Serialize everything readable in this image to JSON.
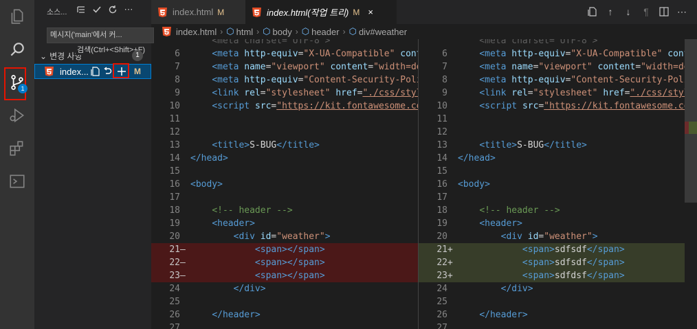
{
  "activity_bar": {
    "scm_badge": "1"
  },
  "sidebar": {
    "title": "소스...",
    "tooltip_commit": "메시지('main'에서 커...",
    "tooltip_search": "검색(Ctrl+<Shift>+F)",
    "changes_header": "변경 사항",
    "changes_count": "1",
    "file": {
      "name": "index...",
      "status": "M"
    }
  },
  "tabs": [
    {
      "label": "index.html",
      "status": "M"
    },
    {
      "label": "index.html(작업 트리)",
      "status": "M",
      "close": "×"
    }
  ],
  "breadcrumb": [
    "index.html",
    "html",
    "body",
    "header",
    "div#weather"
  ],
  "editor": {
    "left": [
      {
        "n": "",
        "marker": "",
        "kind": "plain",
        "code": [
          [
            "t-txt",
            "    <meta charset=\"UTF-8\">"
          ]
        ]
      },
      {
        "n": "6",
        "marker": "",
        "kind": "plain",
        "code": [
          [
            "t-txt",
            "    "
          ],
          [
            "t-tag",
            "<meta "
          ],
          [
            "t-attr",
            "http-equiv"
          ],
          [
            "t-txt",
            "="
          ],
          [
            "t-str",
            "\"X-UA-Compatible\""
          ],
          [
            "t-txt",
            " "
          ],
          [
            "t-attr",
            "cont"
          ]
        ]
      },
      {
        "n": "7",
        "marker": "",
        "kind": "plain",
        "code": [
          [
            "t-txt",
            "    "
          ],
          [
            "t-tag",
            "<meta "
          ],
          [
            "t-attr",
            "name"
          ],
          [
            "t-txt",
            "="
          ],
          [
            "t-str",
            "\"viewport\""
          ],
          [
            "t-txt",
            " "
          ],
          [
            "t-attr",
            "content"
          ],
          [
            "t-txt",
            "="
          ],
          [
            "t-str",
            "\"width=de"
          ]
        ]
      },
      {
        "n": "8",
        "marker": "",
        "kind": "plain",
        "code": [
          [
            "t-txt",
            "    "
          ],
          [
            "t-tag",
            "<meta "
          ],
          [
            "t-attr",
            "http-equiv"
          ],
          [
            "t-txt",
            "="
          ],
          [
            "t-str",
            "\"Content-Security-Poli"
          ]
        ]
      },
      {
        "n": "9",
        "marker": "",
        "kind": "plain",
        "code": [
          [
            "t-txt",
            "    "
          ],
          [
            "t-tag",
            "<link "
          ],
          [
            "t-attr",
            "rel"
          ],
          [
            "t-txt",
            "="
          ],
          [
            "t-str",
            "\"stylesheet\""
          ],
          [
            "t-txt",
            " "
          ],
          [
            "t-attr",
            "href"
          ],
          [
            "t-txt",
            "="
          ],
          [
            "t-link",
            "\"./css/styl"
          ]
        ]
      },
      {
        "n": "10",
        "marker": "",
        "kind": "plain",
        "code": [
          [
            "t-txt",
            "    "
          ],
          [
            "t-tag",
            "<script "
          ],
          [
            "t-attr",
            "src"
          ],
          [
            "t-txt",
            "="
          ],
          [
            "t-link",
            "\"https://kit.fontawesome.co"
          ]
        ]
      },
      {
        "n": "11",
        "marker": "",
        "kind": "plain",
        "code": []
      },
      {
        "n": "12",
        "marker": "",
        "kind": "plain",
        "code": []
      },
      {
        "n": "13",
        "marker": "",
        "kind": "plain",
        "code": [
          [
            "t-txt",
            "    "
          ],
          [
            "t-tag",
            "<title>"
          ],
          [
            "t-txt",
            "S-BUG"
          ],
          [
            "t-tag",
            "</title>"
          ]
        ]
      },
      {
        "n": "14",
        "marker": "",
        "kind": "plain",
        "code": [
          [
            "t-tag",
            "</head>"
          ]
        ]
      },
      {
        "n": "15",
        "marker": "",
        "kind": "plain",
        "code": []
      },
      {
        "n": "16",
        "marker": "",
        "kind": "plain",
        "code": [
          [
            "t-tag",
            "<body>"
          ]
        ]
      },
      {
        "n": "17",
        "marker": "",
        "kind": "plain",
        "code": []
      },
      {
        "n": "18",
        "marker": "",
        "kind": "plain",
        "code": [
          [
            "t-txt",
            "    "
          ],
          [
            "t-com",
            "<!-- header -->"
          ]
        ]
      },
      {
        "n": "19",
        "marker": "",
        "kind": "plain",
        "code": [
          [
            "t-txt",
            "    "
          ],
          [
            "t-tag",
            "<header>"
          ]
        ]
      },
      {
        "n": "20",
        "marker": "",
        "kind": "plain",
        "code": [
          [
            "t-txt",
            "        "
          ],
          [
            "t-tag",
            "<div "
          ],
          [
            "t-attr",
            "id"
          ],
          [
            "t-txt",
            "="
          ],
          [
            "t-str",
            "\"weather\""
          ],
          [
            "t-tag",
            ">"
          ]
        ]
      },
      {
        "n": "21",
        "marker": "—",
        "kind": "del",
        "code": [
          [
            "t-txt",
            "            "
          ],
          [
            "t-tag",
            "<span></span>"
          ]
        ]
      },
      {
        "n": "22",
        "marker": "—",
        "kind": "del",
        "code": [
          [
            "t-txt",
            "            "
          ],
          [
            "t-tag",
            "<span></span>"
          ]
        ]
      },
      {
        "n": "23",
        "marker": "—",
        "kind": "del",
        "code": [
          [
            "t-txt",
            "            "
          ],
          [
            "t-tag",
            "<span></span>"
          ]
        ]
      },
      {
        "n": "24",
        "marker": "",
        "kind": "plain",
        "code": [
          [
            "t-txt",
            "        "
          ],
          [
            "t-tag",
            "</div>"
          ]
        ]
      },
      {
        "n": "25",
        "marker": "",
        "kind": "plain",
        "code": []
      },
      {
        "n": "26",
        "marker": "",
        "kind": "plain",
        "code": [
          [
            "t-txt",
            "    "
          ],
          [
            "t-tag",
            "</header>"
          ]
        ]
      },
      {
        "n": "27",
        "marker": "",
        "kind": "plain",
        "code": []
      }
    ],
    "right": [
      {
        "n": "",
        "marker": "",
        "kind": "plain",
        "code": [
          [
            "t-txt",
            "    <meta charset=\"UTF-8\">"
          ]
        ]
      },
      {
        "n": "6",
        "marker": "",
        "kind": "plain",
        "code": [
          [
            "t-txt",
            "    "
          ],
          [
            "t-tag",
            "<meta "
          ],
          [
            "t-attr",
            "http-equiv"
          ],
          [
            "t-txt",
            "="
          ],
          [
            "t-str",
            "\"X-UA-Compatible\""
          ],
          [
            "t-txt",
            " "
          ],
          [
            "t-attr",
            "cont"
          ]
        ]
      },
      {
        "n": "7",
        "marker": "",
        "kind": "plain",
        "code": [
          [
            "t-txt",
            "    "
          ],
          [
            "t-tag",
            "<meta "
          ],
          [
            "t-attr",
            "name"
          ],
          [
            "t-txt",
            "="
          ],
          [
            "t-str",
            "\"viewport\""
          ],
          [
            "t-txt",
            " "
          ],
          [
            "t-attr",
            "content"
          ],
          [
            "t-txt",
            "="
          ],
          [
            "t-str",
            "\"width=de"
          ]
        ]
      },
      {
        "n": "8",
        "marker": "",
        "kind": "plain",
        "code": [
          [
            "t-txt",
            "    "
          ],
          [
            "t-tag",
            "<meta "
          ],
          [
            "t-attr",
            "http-equiv"
          ],
          [
            "t-txt",
            "="
          ],
          [
            "t-str",
            "\"Content-Security-Poli"
          ]
        ]
      },
      {
        "n": "9",
        "marker": "",
        "kind": "plain",
        "code": [
          [
            "t-txt",
            "    "
          ],
          [
            "t-tag",
            "<link "
          ],
          [
            "t-attr",
            "rel"
          ],
          [
            "t-txt",
            "="
          ],
          [
            "t-str",
            "\"stylesheet\""
          ],
          [
            "t-txt",
            " "
          ],
          [
            "t-attr",
            "href"
          ],
          [
            "t-txt",
            "="
          ],
          [
            "t-link",
            "\"./css/styl"
          ]
        ]
      },
      {
        "n": "10",
        "marker": "",
        "kind": "plain",
        "code": [
          [
            "t-txt",
            "    "
          ],
          [
            "t-tag",
            "<script "
          ],
          [
            "t-attr",
            "src"
          ],
          [
            "t-txt",
            "="
          ],
          [
            "t-link",
            "\"https://kit.fontawesome.co"
          ]
        ]
      },
      {
        "n": "11",
        "marker": "",
        "kind": "plain",
        "code": []
      },
      {
        "n": "12",
        "marker": "",
        "kind": "plain",
        "code": []
      },
      {
        "n": "13",
        "marker": "",
        "kind": "plain",
        "code": [
          [
            "t-txt",
            "    "
          ],
          [
            "t-tag",
            "<title>"
          ],
          [
            "t-txt",
            "S-BUG"
          ],
          [
            "t-tag",
            "</title>"
          ]
        ]
      },
      {
        "n": "14",
        "marker": "",
        "kind": "plain",
        "code": [
          [
            "t-tag",
            "</head>"
          ]
        ]
      },
      {
        "n": "15",
        "marker": "",
        "kind": "plain",
        "code": []
      },
      {
        "n": "16",
        "marker": "",
        "kind": "plain",
        "code": [
          [
            "t-tag",
            "<body>"
          ]
        ]
      },
      {
        "n": "17",
        "marker": "",
        "kind": "plain",
        "code": []
      },
      {
        "n": "18",
        "marker": "",
        "kind": "plain",
        "code": [
          [
            "t-txt",
            "    "
          ],
          [
            "t-com",
            "<!-- header -->"
          ]
        ]
      },
      {
        "n": "19",
        "marker": "",
        "kind": "plain",
        "code": [
          [
            "t-txt",
            "    "
          ],
          [
            "t-tag",
            "<header>"
          ]
        ]
      },
      {
        "n": "20",
        "marker": "",
        "kind": "plain",
        "code": [
          [
            "t-txt",
            "        "
          ],
          [
            "t-tag",
            "<div "
          ],
          [
            "t-attr",
            "id"
          ],
          [
            "t-txt",
            "="
          ],
          [
            "t-str",
            "\"weather\""
          ],
          [
            "t-tag",
            ">"
          ]
        ]
      },
      {
        "n": "21",
        "marker": "+",
        "kind": "ins",
        "code": [
          [
            "t-txt",
            "            "
          ],
          [
            "t-tag",
            "<span>"
          ],
          [
            "t-txt",
            "sdfsdf"
          ],
          [
            "t-tag",
            "</span>"
          ]
        ]
      },
      {
        "n": "22",
        "marker": "+",
        "kind": "ins",
        "code": [
          [
            "t-txt",
            "            "
          ],
          [
            "t-tag",
            "<span>"
          ],
          [
            "t-txt",
            "sdfsdf"
          ],
          [
            "t-tag",
            "</span>"
          ]
        ]
      },
      {
        "n": "23",
        "marker": "+",
        "kind": "ins",
        "code": [
          [
            "t-txt",
            "            "
          ],
          [
            "t-tag",
            "<span>"
          ],
          [
            "t-txt",
            "sdfdsf"
          ],
          [
            "t-tag",
            "</span>"
          ]
        ]
      },
      {
        "n": "24",
        "marker": "",
        "kind": "plain",
        "code": [
          [
            "t-txt",
            "        "
          ],
          [
            "t-tag",
            "</div>"
          ]
        ]
      },
      {
        "n": "25",
        "marker": "",
        "kind": "plain",
        "code": []
      },
      {
        "n": "26",
        "marker": "",
        "kind": "plain",
        "code": [
          [
            "t-txt",
            "    "
          ],
          [
            "t-tag",
            "</header>"
          ]
        ]
      },
      {
        "n": "27",
        "marker": "",
        "kind": "plain",
        "code": []
      }
    ]
  },
  "colors": {
    "accent": "#007acc",
    "highlight_box": "#e51400",
    "deleted_line": "#4b1818",
    "inserted_line": "#373d29",
    "modified": "#e2c08d"
  }
}
